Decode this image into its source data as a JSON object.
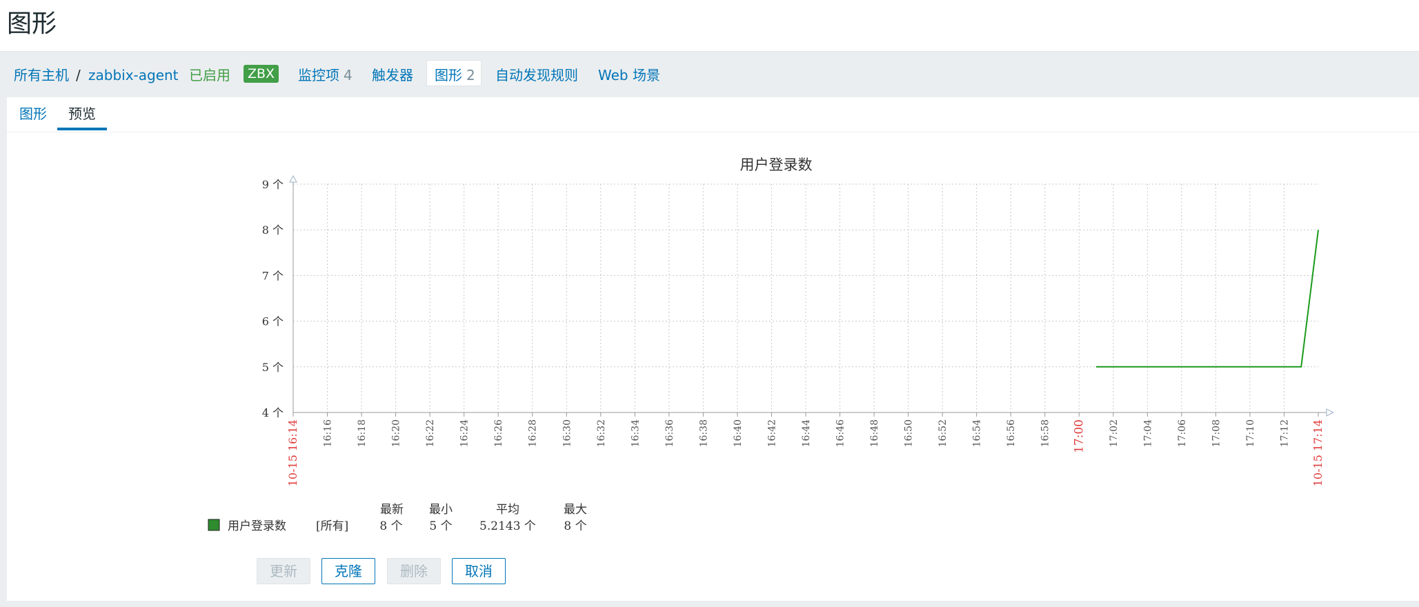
{
  "page": {
    "title": "图形"
  },
  "nav": {
    "all_hosts": "所有主机",
    "separator": "/",
    "host": "zabbix-agent",
    "status": "已启用",
    "badge": "ZBX",
    "items_label": "监控项",
    "items_count": "4",
    "triggers_label": "触发器",
    "graphs_label": "图形",
    "graphs_count": "2",
    "discovery_label": "自动发现规则",
    "web_label": "Web 场景"
  },
  "tabs": {
    "graph": "图形",
    "preview": "预览"
  },
  "chart_data": {
    "type": "line",
    "title": "用户登录数",
    "y_unit": "个",
    "yticks": [
      "4 个",
      "5 个",
      "6 个",
      "7 个",
      "8 个",
      "9 个"
    ],
    "ylim": [
      4,
      9
    ],
    "xlim": [
      "16:14",
      "17:14"
    ],
    "xticks": [
      "16:16",
      "16:18",
      "16:20",
      "16:22",
      "16:24",
      "16:26",
      "16:28",
      "16:30",
      "16:32",
      "16:34",
      "16:36",
      "16:38",
      "16:40",
      "16:42",
      "16:44",
      "16:46",
      "16:48",
      "16:50",
      "16:52",
      "16:54",
      "16:56",
      "16:58",
      "17:00",
      "17:02",
      "17:04",
      "17:06",
      "17:08",
      "17:10",
      "17:12"
    ],
    "x_start_label": "10-15 16:14",
    "x_end_label": "10-15 17:14",
    "x_highlight_label": "17:00",
    "grid": true,
    "series": [
      {
        "name": "用户登录数",
        "color": "#1a9a1a",
        "points": [
          {
            "x": "17:01",
            "y": 5
          },
          {
            "x": "17:13",
            "y": 5
          },
          {
            "x": "17:14",
            "y": 8
          }
        ]
      }
    ],
    "legend": {
      "series_name": "用户登录数",
      "func": "[所有]",
      "headers": [
        "最新",
        "最小",
        "平均",
        "最大"
      ],
      "values": [
        "8 个",
        "5 个",
        "5.2143 个",
        "8 个"
      ]
    }
  },
  "buttons": {
    "update": "更新",
    "clone": "克隆",
    "delete": "删除",
    "cancel": "取消"
  }
}
